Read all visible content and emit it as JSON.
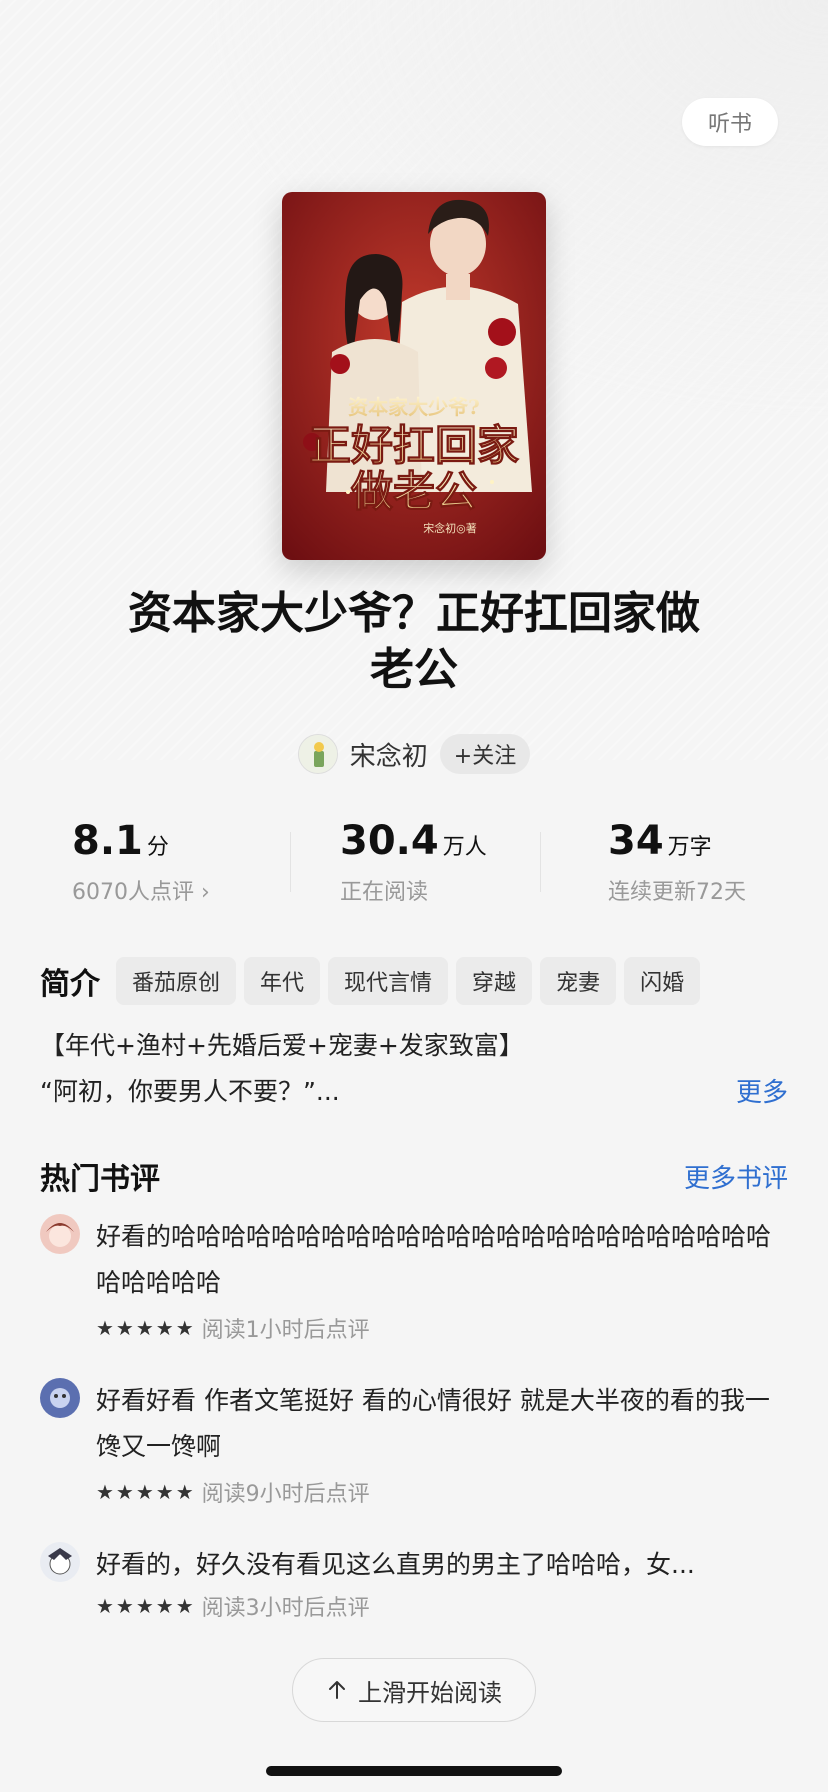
{
  "header": {
    "listen_label": "听书"
  },
  "book": {
    "title_line1": "资本家大少爷？正好扛回家做",
    "title_line2": "老公",
    "cover": {
      "small_title": "资本家大少爷?",
      "big_title_1": "正好扛回家",
      "big_title_2": "做老公",
      "author_mark": "宋念初◎著"
    }
  },
  "author": {
    "name": "宋念初",
    "follow_label": "+关注"
  },
  "stats": {
    "score": "8.1",
    "score_unit": "分",
    "score_sub": "6070人点评 ›",
    "readers": "30.4",
    "readers_unit": "万人",
    "readers_sub": "正在阅读",
    "words": "34",
    "words_unit": "万字",
    "words_sub": "连续更新72天"
  },
  "intro": {
    "title": "简介",
    "tags": [
      "番茄原创",
      "年代",
      "现代言情",
      "穿越",
      "宠妻",
      "闪婚"
    ],
    "line1": "【年代+渔村+先婚后爱+宠妻+发家致富】",
    "line2": "“阿初，你要男人不要？”...",
    "more_label": "更多"
  },
  "reviews": {
    "title": "热门书评",
    "more_label": "更多书评",
    "items": [
      {
        "text": "好看的哈哈哈哈哈哈哈哈哈哈哈哈哈哈哈哈哈哈哈哈哈哈哈哈哈哈哈哈哈",
        "stars": "★★★★★",
        "meta": "阅读1小时后点评"
      },
      {
        "text": "好看好看 作者文笔挺好 看的心情很好 就是大半夜的看的我一馋又一馋啊",
        "stars": "★★★★★",
        "meta": "阅读9小时后点评"
      },
      {
        "text": "好看的，好久没有看见这么直男的男主了哈哈哈，女...",
        "stars": "★★★★★",
        "meta": "阅读3小时后点评"
      }
    ]
  },
  "footer": {
    "start_label": "上滑开始阅读"
  },
  "colors": {
    "accent": "#2f6fd0",
    "cover_red": "#9b1c1c"
  }
}
